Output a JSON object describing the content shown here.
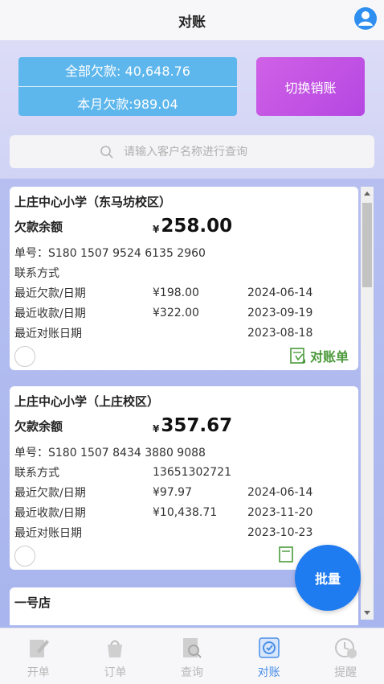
{
  "header": {
    "title": "对账"
  },
  "summary": {
    "total_debt": "全部欠款: 40,648.76",
    "month_debt": "本月欠款:989.04"
  },
  "switch_button": "切换销账",
  "search": {
    "placeholder": "请输入客户名称进行查询"
  },
  "cards": [
    {
      "name": "上庄中心小学（东马坊校区）",
      "balance_label": "欠款余额",
      "currency": "¥",
      "balance": "258.00",
      "order_no": "单号：S180 1507 9524 6135 2960",
      "contact_label": "联系方式",
      "contact_value": "",
      "last_debt_label": "最近欠款/日期",
      "last_debt_amount": "¥198.00",
      "last_debt_date": "2024-06-14",
      "last_receipt_label": "最近收款/日期",
      "last_receipt_amount": "¥322.00",
      "last_receipt_date": "2023-09-19",
      "last_recon_label": "最近对账日期",
      "last_recon_date": "2023-08-18",
      "recon_link": "对账单"
    },
    {
      "name": "上庄中心小学（上庄校区）",
      "balance_label": "欠款余额",
      "currency": "¥",
      "balance": "357.67",
      "order_no": "单号：S180 1507 8434 3880 9088",
      "contact_label": "联系方式",
      "contact_value": "13651302721",
      "last_debt_label": "最近欠款/日期",
      "last_debt_amount": "¥97.97",
      "last_debt_date": "2024-06-14",
      "last_receipt_label": "最近收款/日期",
      "last_receipt_amount": "¥10,438.71",
      "last_receipt_date": "2023-11-20",
      "last_recon_label": "最近对账日期",
      "last_recon_date": "2023-10-23",
      "recon_link": ""
    },
    {
      "name": "一号店"
    }
  ],
  "fab": "批量",
  "tabs": [
    {
      "label": "开单",
      "icon": "order-pen-icon"
    },
    {
      "label": "订单",
      "icon": "bag-icon"
    },
    {
      "label": "查询",
      "icon": "search-doc-icon"
    },
    {
      "label": "对账",
      "icon": "reconcile-icon"
    },
    {
      "label": "提醒",
      "icon": "clock-dollar-icon"
    }
  ],
  "colors": {
    "accent_blue": "#1e7bf0",
    "summary_blue": "#5db6ec",
    "switch_purple": "#c052e4",
    "recon_green": "#4a9a3a",
    "active_tab": "#4a8ee8"
  }
}
